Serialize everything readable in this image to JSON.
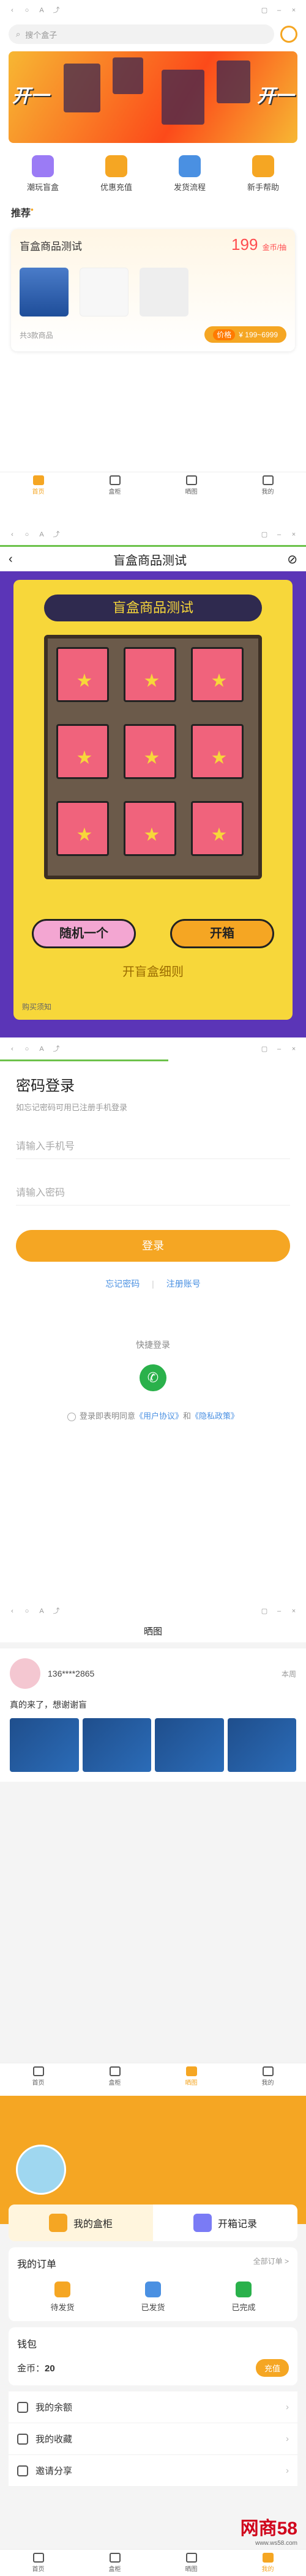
{
  "home": {
    "search_placeholder": "搜个盒子",
    "banner_text": "开一",
    "quick_links": [
      {
        "label": "潮玩盲盒",
        "icon": "gift-box-icon",
        "color": "#9b7bf5"
      },
      {
        "label": "优惠充值",
        "icon": "wallet-icon",
        "color": "#f5a623"
      },
      {
        "label": "发货流程",
        "icon": "truck-icon",
        "color": "#4a90e2"
      },
      {
        "label": "新手帮助",
        "icon": "book-icon",
        "color": "#f5a623"
      }
    ],
    "recommend_title": "推荐",
    "card": {
      "title": "盲盒商品测试",
      "price": "199",
      "price_unit": "金币/抽",
      "count_text": "共3款商品",
      "range_label": "价格",
      "range_value": "¥ 199~6999"
    }
  },
  "tabs": [
    {
      "label": "首页",
      "icon": "home-icon"
    },
    {
      "label": "盒柜",
      "icon": "cabinet-icon"
    },
    {
      "label": "晒图",
      "icon": "grid-icon"
    },
    {
      "label": "我的",
      "icon": "user-icon"
    }
  ],
  "blindbox": {
    "nav_title": "盲盒商品测试",
    "machine_title": "盲盒商品测试",
    "random_button": "随机一个",
    "open_button": "开箱",
    "rules": "开盲盒细则",
    "notice": "购买须知"
  },
  "login": {
    "title": "密码登录",
    "subtitle": "如忘记密码可用已注册手机登录",
    "phone_placeholder": "请输入手机号",
    "password_placeholder": "请输入密码",
    "login_button": "登录",
    "forgot": "忘记密码",
    "register": "注册账号",
    "quick_login": "快捷登录",
    "agree_prefix": "登录即表明同意",
    "user_agreement": "《用户协议》",
    "and": "和",
    "privacy": "《隐私政策》"
  },
  "show": {
    "title": "晒图",
    "user": "136****2865",
    "date": "本周",
    "text": "真的来了，想谢谢盲"
  },
  "profile": {
    "tab_cabinet": "我的盒柜",
    "tab_records": "开箱记录",
    "orders_title": "我的订单",
    "orders_more": "全部订单 >",
    "orders": [
      {
        "label": "待发货",
        "icon": "pending-icon",
        "color": "#f5a623"
      },
      {
        "label": "已发货",
        "icon": "shipped-icon",
        "color": "#4a90e2"
      },
      {
        "label": "已完成",
        "icon": "done-icon",
        "color": "#2ab14b"
      }
    ],
    "wallet_title": "钱包",
    "coins_label": "金币：",
    "coins_value": "20",
    "charge_button": "充值",
    "menu": [
      {
        "label": "我的余额",
        "icon": "balance-icon"
      },
      {
        "label": "我的收藏",
        "icon": "favorite-icon"
      },
      {
        "label": "邀请分享",
        "icon": "share-icon"
      }
    ],
    "watermark": "网商58",
    "watermark_sub": "www.ws58.com"
  }
}
